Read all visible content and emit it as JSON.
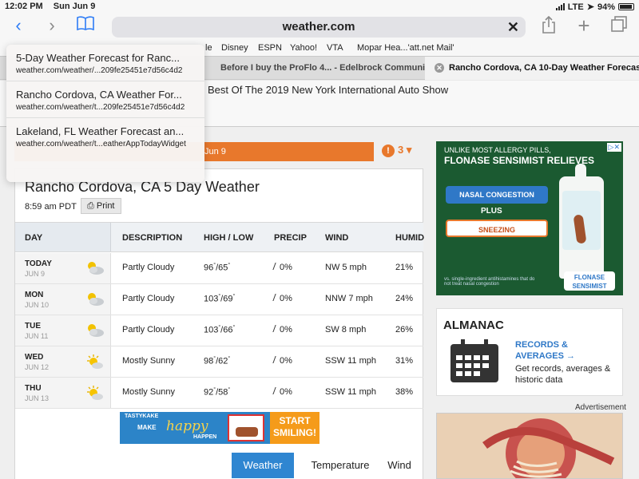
{
  "status_bar": {
    "time": "12:02 PM",
    "date": "Sun Jun 9",
    "network": "LTE",
    "battery": "94%"
  },
  "toolbar": {
    "url": "weather.com"
  },
  "favorites": [
    "le",
    "Disney",
    "ESPN",
    "Yahoo!",
    "VTA",
    "Mopar Hea...'att.net Mail'"
  ],
  "tabs": [
    {
      "label": "Before I buy the ProFlo 4... - Edelbrock Communi..."
    },
    {
      "label": "Rancho Cordova, CA 10-Day Weather Forecast..."
    }
  ],
  "suggestions": [
    {
      "title": "5-Day Weather Forecast for Ranc...",
      "url": "weather.com/weather/...209fe25451e7d56c4d2"
    },
    {
      "title": "Rancho Cordova, CA Weather For...",
      "url": "weather.com/weather/t...209fe25451e7d56c4d2"
    },
    {
      "title": "Lakeland, FL Weather Forecast an...",
      "url": "weather.com/weather/t...eatherAppTodayWidget"
    }
  ],
  "page": {
    "news_headline": "Best Of The 2019 New York International Auto Show",
    "alert_text": "Jun 9",
    "alert_count": "3",
    "title": "Rancho Cordova, CA 5 Day Weather",
    "time": "8:59 am PDT",
    "print_label": "Print"
  },
  "table": {
    "headers": [
      "DAY",
      "DESCRIPTION",
      "HIGH / LOW",
      "PRECIP",
      "WIND",
      "HUMID"
    ],
    "rows": [
      {
        "day": "TODAY",
        "date": "JUN 9",
        "icon": "partly-cloudy-icon",
        "desc": "Partly Cloudy",
        "high": "96",
        "low": "65",
        "precip": "0%",
        "wind": "NW 5 mph",
        "humidity": "21%"
      },
      {
        "day": "MON",
        "date": "JUN 10",
        "icon": "partly-cloudy-icon",
        "desc": "Partly Cloudy",
        "high": "103",
        "low": "69",
        "precip": "0%",
        "wind": "NNW 7 mph",
        "humidity": "24%"
      },
      {
        "day": "TUE",
        "date": "JUN 11",
        "icon": "partly-cloudy-icon",
        "desc": "Partly Cloudy",
        "high": "103",
        "low": "66",
        "precip": "0%",
        "wind": "SW 8 mph",
        "humidity": "26%"
      },
      {
        "day": "WED",
        "date": "JUN 12",
        "icon": "mostly-sunny-icon",
        "desc": "Mostly Sunny",
        "high": "98",
        "low": "62",
        "precip": "0%",
        "wind": "SSW 11 mph",
        "humidity": "31%"
      },
      {
        "day": "THU",
        "date": "JUN 13",
        "icon": "mostly-sunny-icon",
        "desc": "Mostly Sunny",
        "high": "92",
        "low": "58",
        "precip": "0%",
        "wind": "SSW 11 mph",
        "humidity": "38%"
      }
    ]
  },
  "banner_ad": {
    "brand": "TASTYKAKE",
    "make": "MAKE",
    "happy": "happy",
    "happen": "HAPPEN",
    "cta": "START SMILING!"
  },
  "subtabs": [
    "Weather",
    "Temperature",
    "Wind"
  ],
  "allergy_ad": {
    "line1": "UNLIKE MOST ALLERGY PILLS,",
    "line2": "FLONASE SENSIMIST RELIEVES",
    "pill1": "NASAL CONGESTION",
    "plus": "PLUS",
    "pill2": "SNEEZING",
    "fine_print": "vs. single-ingredient antihistamines that do not treat nasal congestion",
    "brand": "FLONASE SENSIMIST"
  },
  "almanac": {
    "title": "ALMANAC",
    "link": "RECORDS & AVERAGES →",
    "desc": "Get records, averages & historic data"
  },
  "advertisement_label": "Advertisement",
  "colors": {
    "accent": "#2d7cf6",
    "alert": "#e8782c",
    "tab_active": "#2f86d1"
  }
}
